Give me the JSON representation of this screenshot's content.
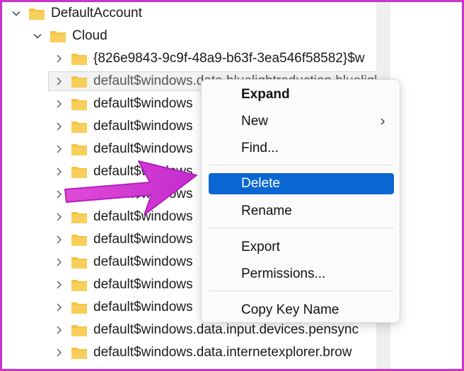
{
  "tree": {
    "root": {
      "label": "DefaultAccount",
      "icon": "folder-icon",
      "expanded": true
    },
    "cloud": {
      "label": "Cloud",
      "icon": "folder-icon",
      "expanded": true
    },
    "items": [
      "{826e9843-9c9f-48a9-b63f-3ea546f58582}$w",
      "default$windows.data.bluelightreduction.bluelightreducti",
      "default$windows",
      "default$windows",
      "default$windows",
      "default$windows",
      "default$windows",
      "default$windows",
      "default$windows",
      "default$windows",
      "default$windows",
      "default$windows",
      "default$windows.data.input.devices.pensync",
      "default$windows.data.internetexplorer.brow"
    ],
    "selected_index": 1
  },
  "context_menu": {
    "items": [
      {
        "label": "Expand",
        "bold": true
      },
      {
        "label": "New",
        "submenu": true,
        "chevron_icon": "chevron-right-icon"
      },
      {
        "label": "Find..."
      },
      {
        "label": "Delete",
        "highlighted": true
      },
      {
        "label": "Rename"
      },
      {
        "label": "Export"
      },
      {
        "label": "Permissions..."
      },
      {
        "label": "Copy Key Name"
      }
    ]
  },
  "annotation": {
    "icon": "arrow-icon",
    "color": "#d63ad6"
  },
  "colors": {
    "folder": "#f5c343",
    "highlight": "#0a66d0",
    "frame": "#c935c9"
  }
}
